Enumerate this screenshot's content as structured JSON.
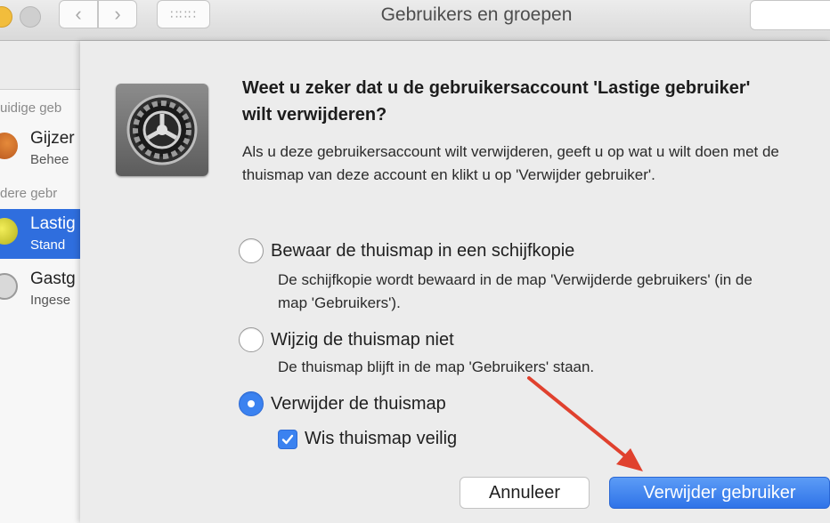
{
  "window": {
    "title": "Gebruikers en groepen",
    "back_glyph": "‹",
    "forward_glyph": "›",
    "grid_glyph": "∷∷∷"
  },
  "sidebar": {
    "current_users_label": "uidige geb",
    "other_users_label": "dere gebr",
    "items": [
      {
        "name": "Gijzer",
        "sub": "Behee",
        "selected": false
      },
      {
        "name": "Lastig",
        "sub": "Stand",
        "selected": true
      },
      {
        "name": "Gastg",
        "sub": "Ingese",
        "selected": false
      }
    ]
  },
  "dialog": {
    "icon": "gear-icon",
    "title": "Weet u zeker dat u de gebruikersaccount 'Lastige gebruiker' wilt verwijderen?",
    "message": "Als u deze gebruikersaccount wilt verwijderen, geeft u op wat u wilt doen met de thuismap van deze account en klikt u op 'Verwijder gebruiker'.",
    "options": [
      {
        "label": "Bewaar de thuismap in een schijfkopie",
        "description": "De schijfkopie wordt bewaard in de map 'Verwijderde gebruikers' (in de map 'Gebruikers').",
        "checked": false
      },
      {
        "label": "Wijzig de thuismap niet",
        "description": "De thuismap blijft in de map 'Gebruikers' staan.",
        "checked": false
      },
      {
        "label": "Verwijder de thuismap",
        "description": "",
        "checked": true
      }
    ],
    "secure_erase": {
      "label": "Wis thuismap veilig",
      "checked": true
    },
    "cancel_label": "Annuleer",
    "confirm_label": "Verwijder gebruiker"
  },
  "colors": {
    "accent": "#3b82f0",
    "annotation_arrow": "#e0412e"
  }
}
